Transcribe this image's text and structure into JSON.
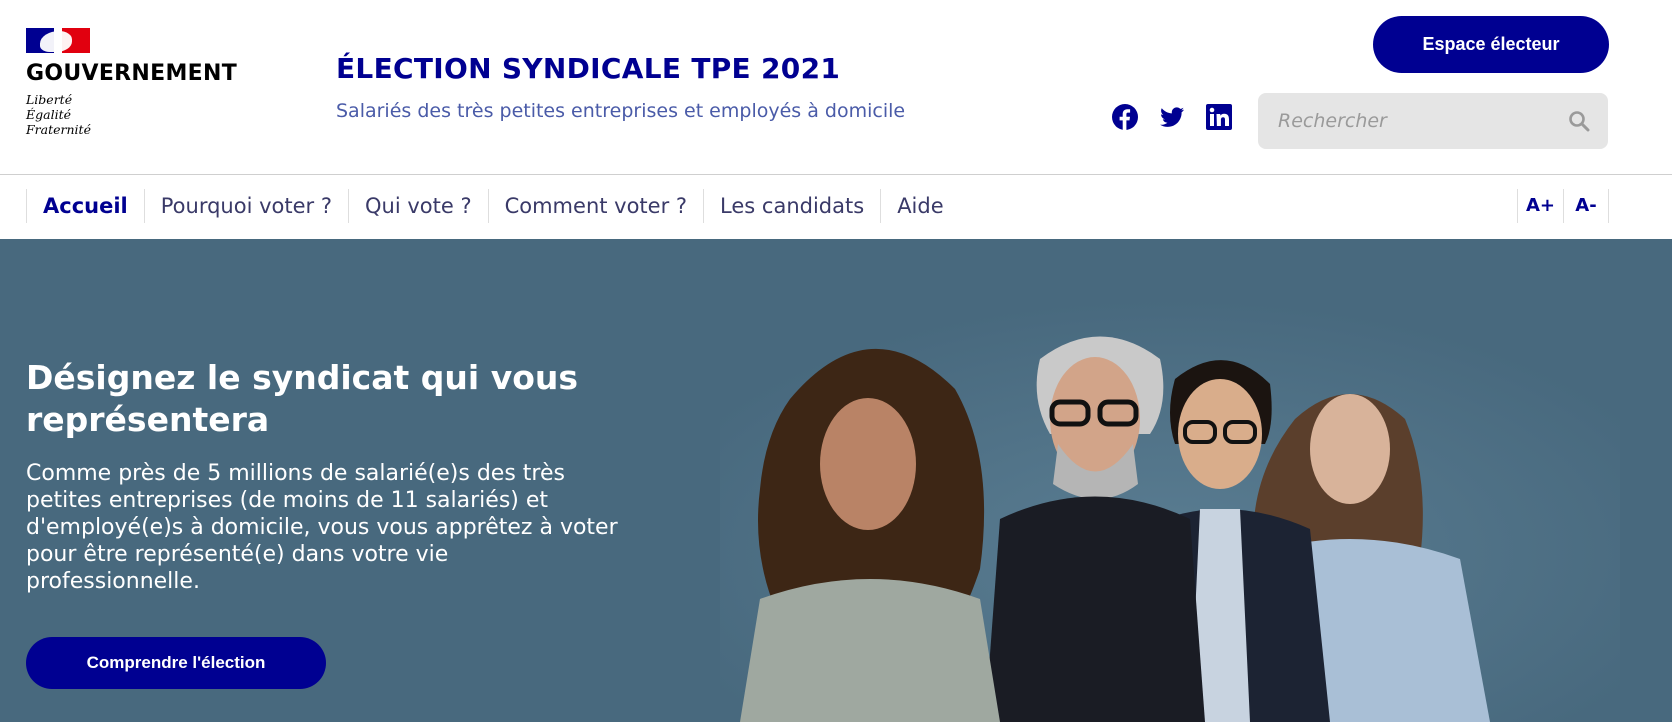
{
  "header": {
    "gov_name": "GOUVERNEMENT",
    "motto": [
      "Liberté",
      "Égalité",
      "Fraternité"
    ],
    "site_title": "ÉLECTION SYNDICALE TPE 2021",
    "site_tagline": "Salariés des très petites entreprises et employés à domicile",
    "espace_button": "Espace électeur",
    "socials": [
      {
        "name": "facebook-icon"
      },
      {
        "name": "twitter-icon"
      },
      {
        "name": "linkedin-icon"
      }
    ],
    "search": {
      "placeholder": "Rechercher",
      "value": ""
    }
  },
  "nav": {
    "items": [
      {
        "label": "Accueil",
        "active": true
      },
      {
        "label": "Pourquoi voter ?",
        "active": false
      },
      {
        "label": "Qui vote ?",
        "active": false
      },
      {
        "label": "Comment voter ?",
        "active": false
      },
      {
        "label": "Les candidats",
        "active": false
      },
      {
        "label": "Aide",
        "active": false
      }
    ],
    "font_increase": "A+",
    "font_decrease": "A-"
  },
  "hero": {
    "title": "Désignez le syndicat qui vous représentera",
    "text": "Comme près de 5 millions de salarié(e)s des très petites entreprises (de moins de 11 salariés) et d'employé(e)s à domicile, vous vous apprêtez à voter pour être représenté(e) dans votre vie professionnelle.",
    "cta": "Comprendre l'élection"
  },
  "colors": {
    "primary": "#000091",
    "hero_bg": "#48697e",
    "tagline": "#4a5ba8",
    "flag_red": "#e1000f"
  }
}
